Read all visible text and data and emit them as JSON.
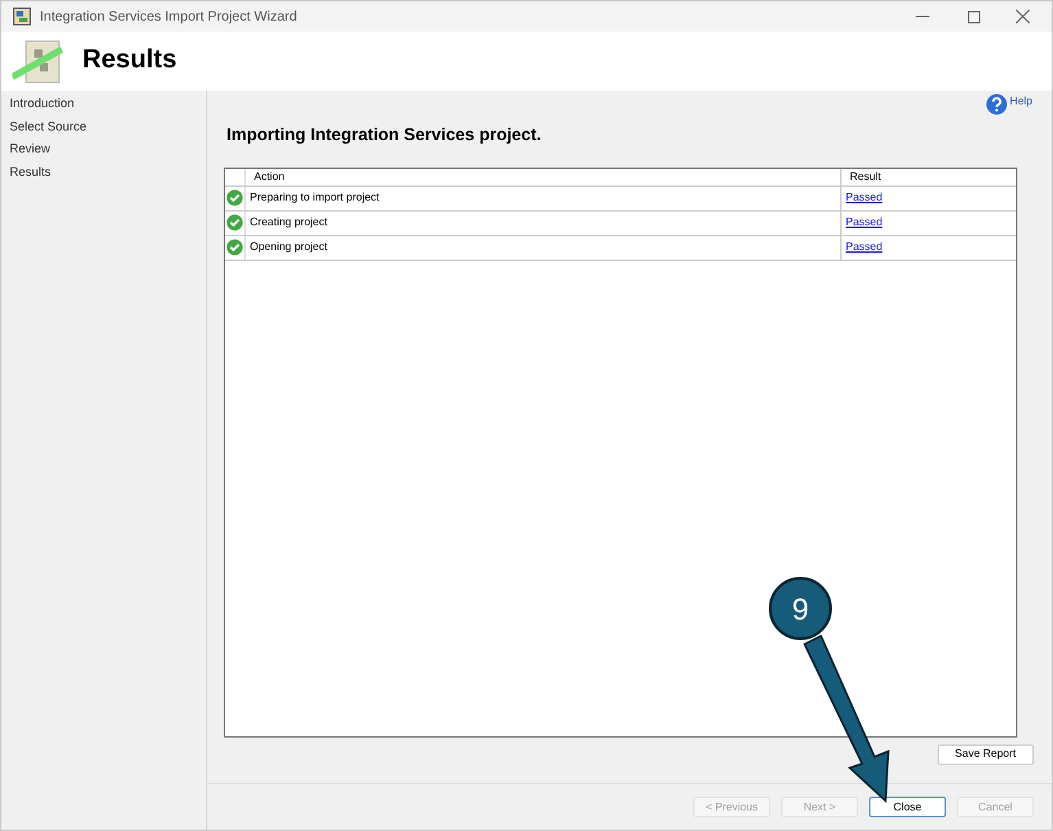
{
  "window": {
    "title": "Integration Services Import Project Wizard"
  },
  "header": {
    "title": "Results"
  },
  "sidebar": {
    "items": [
      "Introduction",
      "Select Source",
      "Review",
      "Results"
    ]
  },
  "help": {
    "label": "Help"
  },
  "heading": "Importing Integration Services project.",
  "table": {
    "columns": [
      "Action",
      "Result"
    ],
    "rows": [
      {
        "action": "Preparing to import project",
        "result": "Passed"
      },
      {
        "action": "Creating project",
        "result": "Passed"
      },
      {
        "action": "Opening project",
        "result": "Passed"
      }
    ]
  },
  "save_report": "Save Report",
  "buttons": [
    {
      "label": "< Previous",
      "disabled": true
    },
    {
      "label": "Next >",
      "disabled": true
    },
    {
      "label": "Close",
      "disabled": false
    },
    {
      "label": "Cancel",
      "disabled": true
    }
  ],
  "callout": {
    "label": "9"
  }
}
